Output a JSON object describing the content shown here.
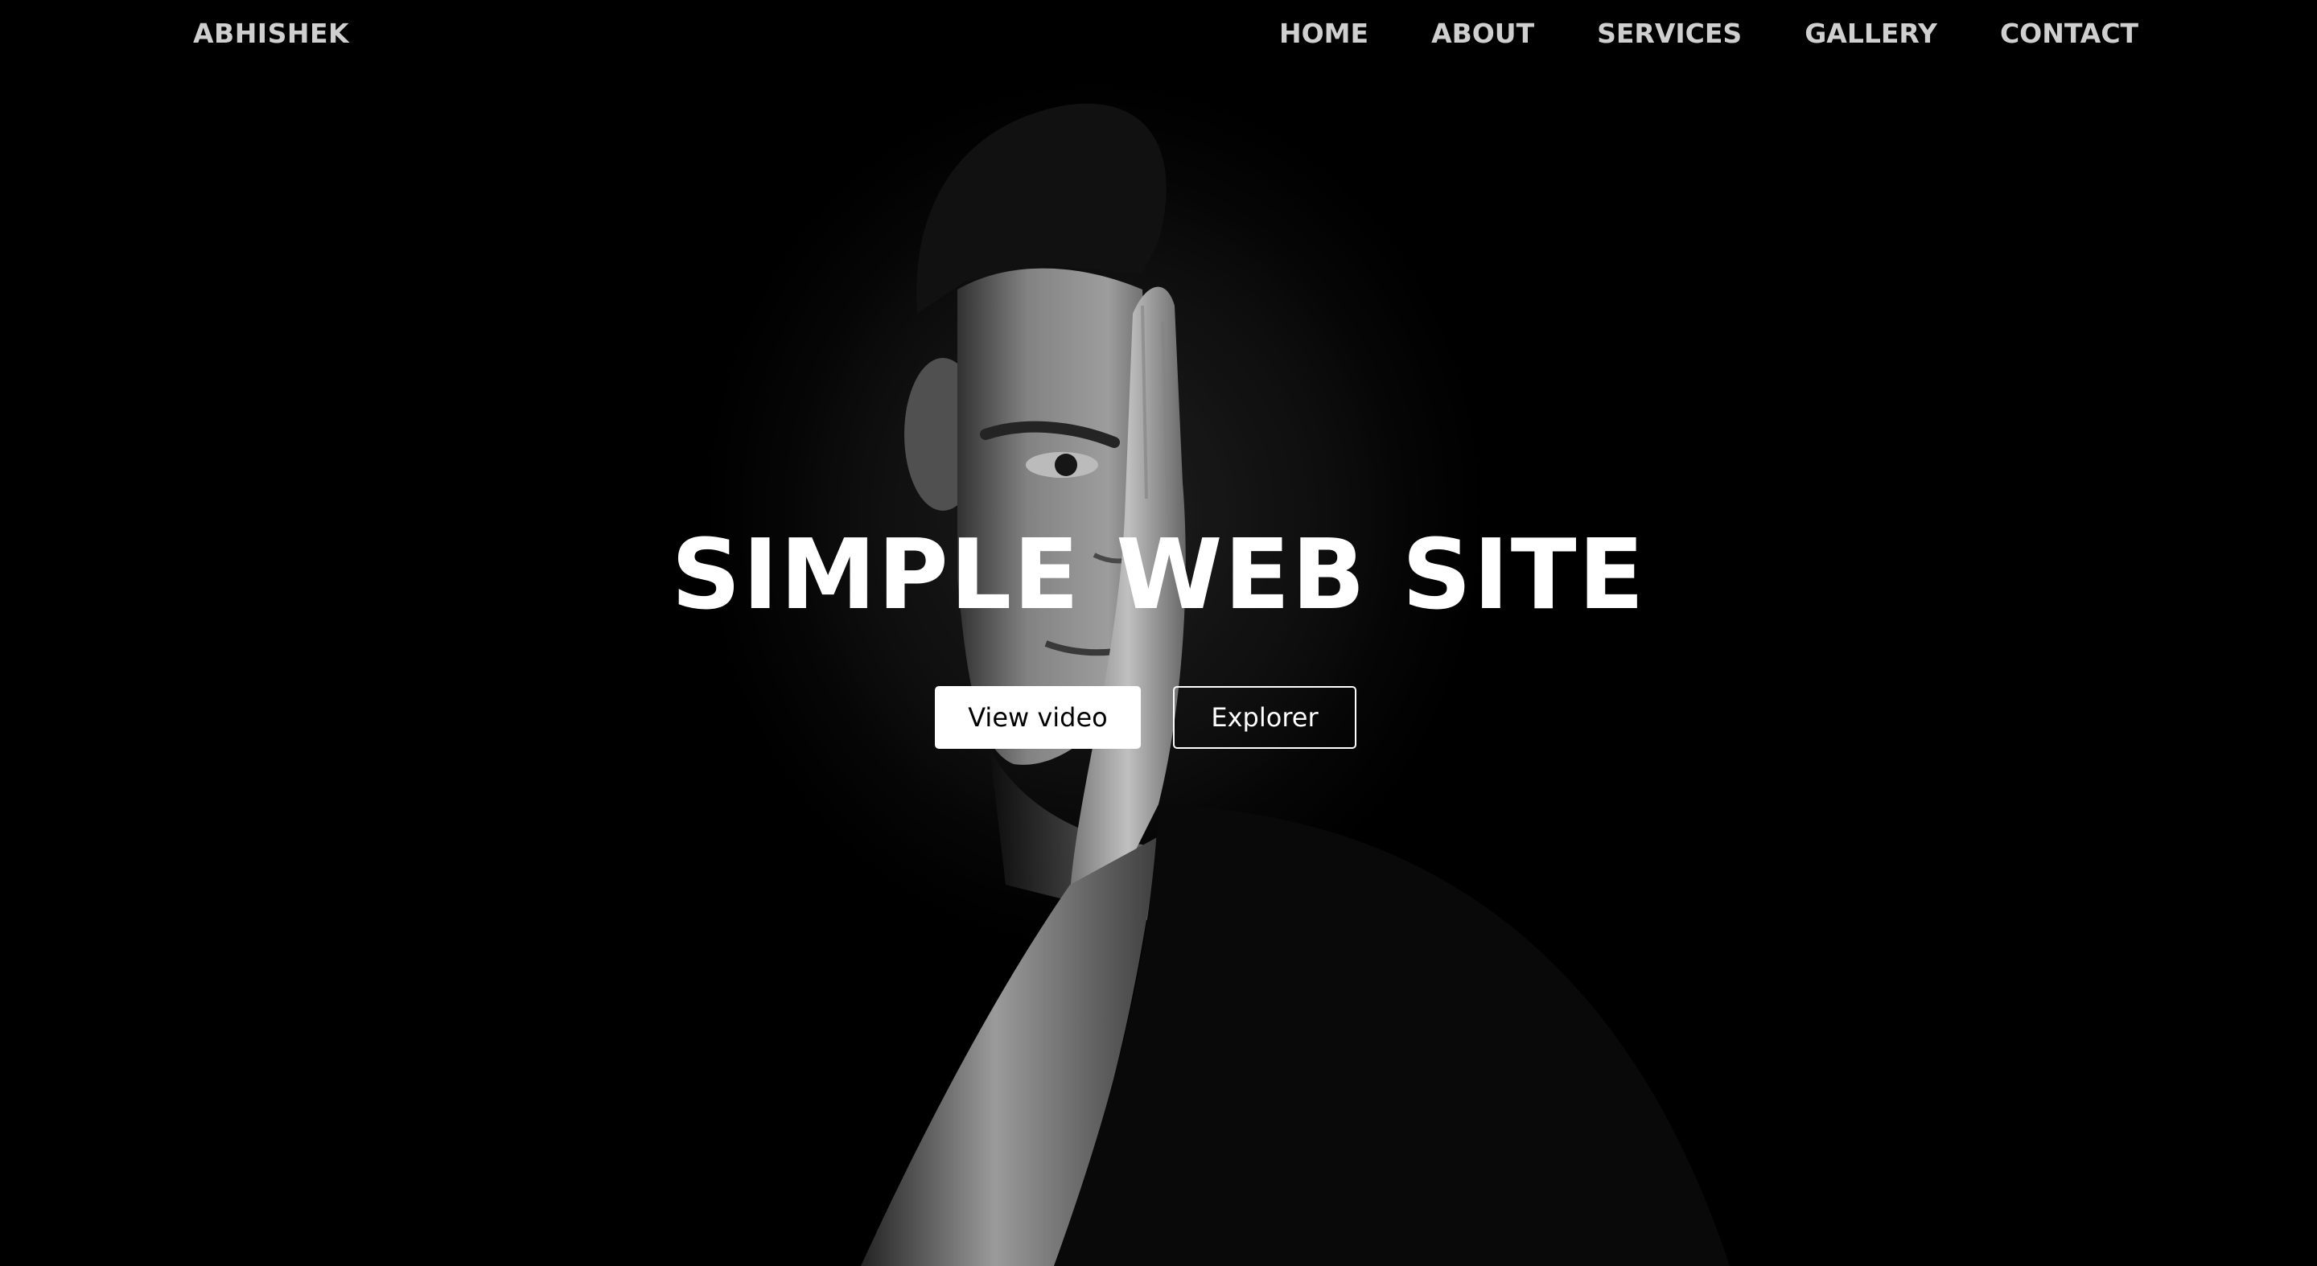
{
  "site": {
    "brand": "ABHISHEK"
  },
  "nav": {
    "items": [
      {
        "label": "HOME"
      },
      {
        "label": "ABOUT"
      },
      {
        "label": "SERVICES"
      },
      {
        "label": "GALLERY"
      },
      {
        "label": "CONTACT"
      }
    ]
  },
  "hero": {
    "title": "SIMPLE WEB SITE",
    "primary_button": "View video",
    "secondary_button": "Explorer"
  },
  "colors": {
    "background": "#000000",
    "nav_text": "#cfcfcf",
    "title_text": "#ffffff",
    "primary_button_bg": "#ffffff",
    "primary_button_text": "#000000",
    "outline_button_border": "#ffffff"
  }
}
